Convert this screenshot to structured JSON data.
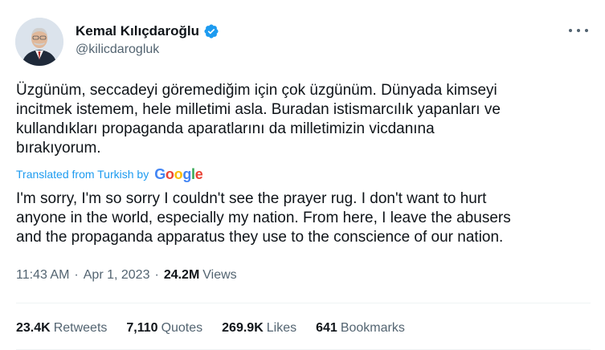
{
  "author": {
    "name": "Kemal Kılıçdaroğlu",
    "handle": "@kilicdarogluk",
    "verified_color": "#1d9bf0"
  },
  "tweet": {
    "text": "Üzgünüm, seccadeyi göremediğim için çok üzgünüm. Dünyada kimseyi\nincitmek istemem, hele milletimi asla. Buradan istismarcılık yapanları ve\nkullandıkları propaganda aparatlarını da milletimizin vicdanına\nbırakıyorum.",
    "translated_label": "Translated from Turkish by",
    "translation_provider": "Google",
    "translation": "I'm sorry, I'm so sorry I couldn't see the prayer rug. I don't want to hurt\nanyone in the world, especially my nation. From here, I leave the abusers\nand the propaganda apparatus they use to the conscience of our nation."
  },
  "meta": {
    "time": "11:43 AM",
    "separator": "·",
    "date": "Apr 1, 2023",
    "views_count": "24.2M",
    "views_label": "Views"
  },
  "stats": {
    "retweets_count": "23.4K",
    "retweets_label": "Retweets",
    "quotes_count": "7,110",
    "quotes_label": "Quotes",
    "likes_count": "269.9K",
    "likes_label": "Likes",
    "bookmarks_count": "641",
    "bookmarks_label": "Bookmarks"
  },
  "colors": {
    "text": "#0f1419",
    "secondary": "#536471",
    "link": "#1d9bf0",
    "divider": "#eff3f4"
  }
}
